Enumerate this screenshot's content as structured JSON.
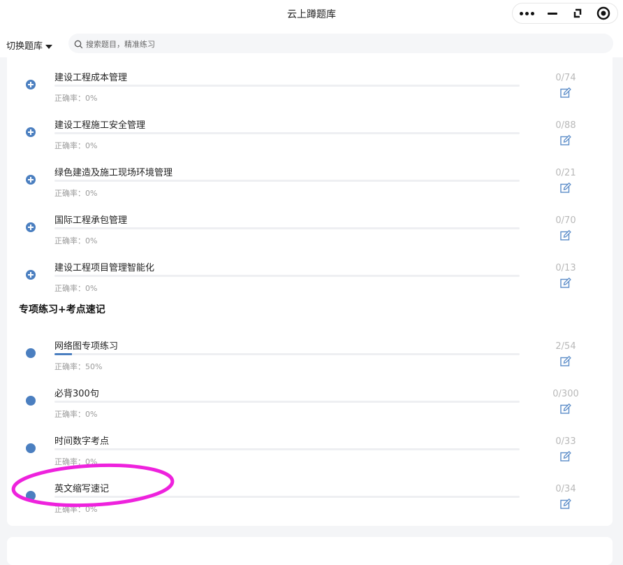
{
  "header": {
    "title": "云上蹲题库"
  },
  "capsule": {
    "more": "more-icon",
    "minimize": "minimize-icon",
    "restore": "restore-icon",
    "close": "target-icon"
  },
  "toolbar": {
    "switch_label": "切换题库",
    "search_placeholder": "搜索题目，精准练习"
  },
  "rows_top": [
    {
      "name": "建设工程成本管理",
      "rate": "正确率：0%",
      "count": "0/74",
      "progress": 0
    },
    {
      "name": "建设工程施工安全管理",
      "rate": "正确率：0%",
      "count": "0/88",
      "progress": 0
    },
    {
      "name": "绿色建造及施工现场环境管理",
      "rate": "正确率：0%",
      "count": "0/21",
      "progress": 0
    },
    {
      "name": "国际工程承包管理",
      "rate": "正确率：0%",
      "count": "0/70",
      "progress": 0
    },
    {
      "name": "建设工程项目管理智能化",
      "rate": "正确率：0%",
      "count": "0/13",
      "progress": 0
    }
  ],
  "section": {
    "title": "专项练习+考点速记"
  },
  "rows_special": [
    {
      "name": "网络图专项练习",
      "rate": "正确率：50%",
      "count": "2/54",
      "progress": 0.037
    },
    {
      "name": "必背300句",
      "rate": "正确率：0%",
      "count": "0/300",
      "progress": 0
    },
    {
      "name": "时间数字考点",
      "rate": "正确率：0%",
      "count": "0/33",
      "progress": 0
    },
    {
      "name": "英文缩写速记",
      "rate": "正确率：0%",
      "count": "0/34",
      "progress": 0
    }
  ],
  "colors": {
    "accent": "#4b7fc0",
    "annotation": "#ee22dd",
    "muted": "#b8b8b8"
  }
}
